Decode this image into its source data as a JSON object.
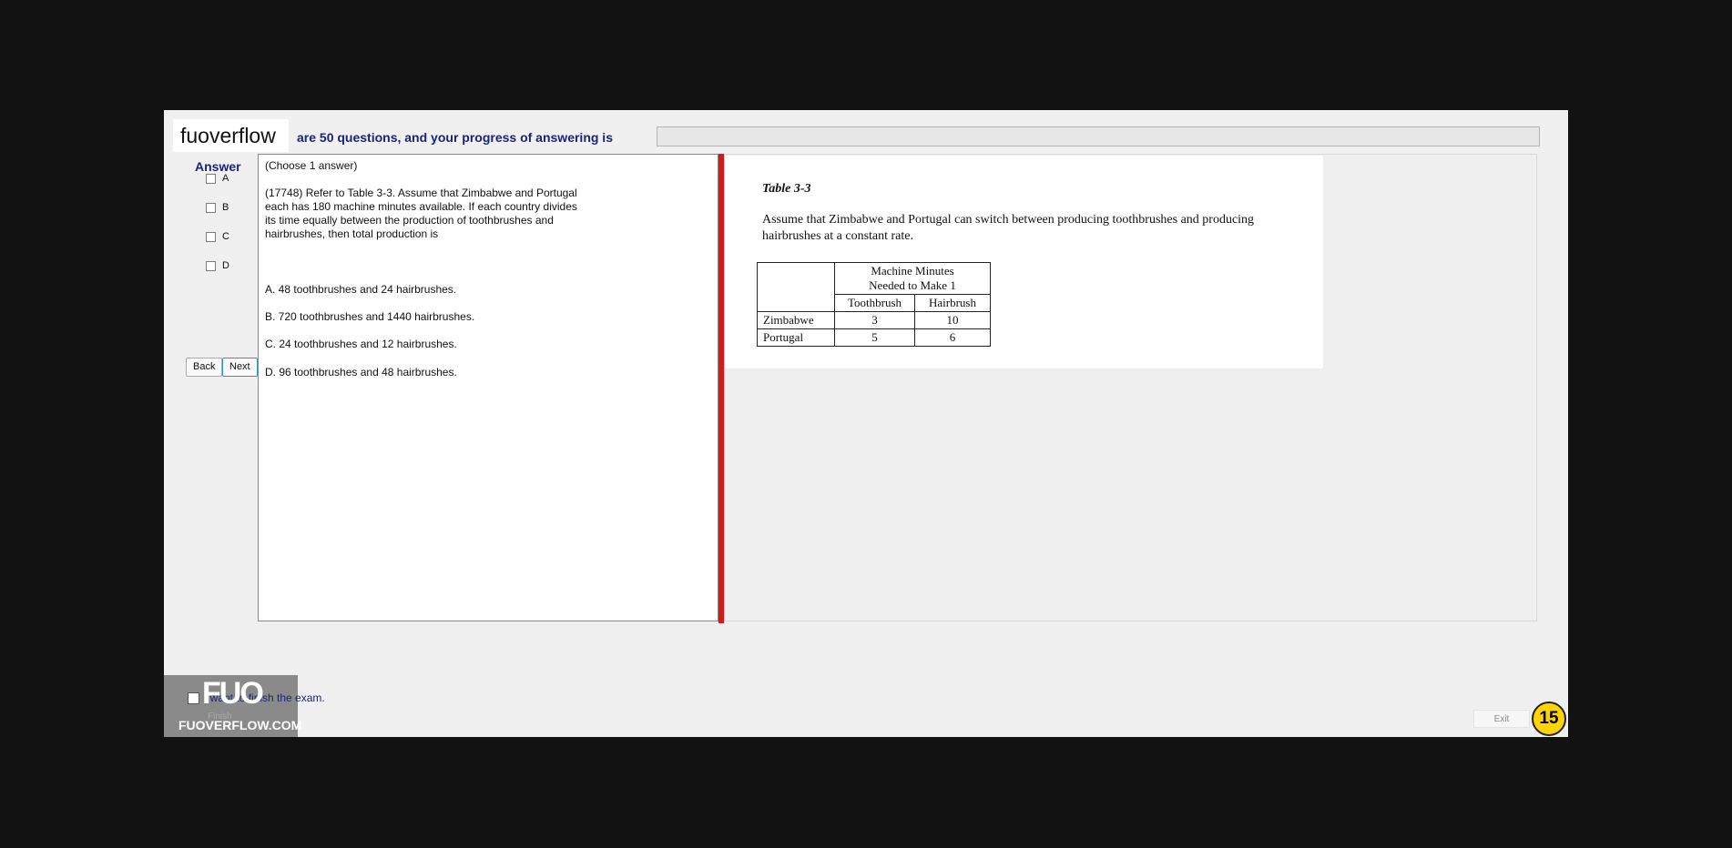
{
  "brand": "fuoverflow",
  "progress": {
    "text": "are 50 questions, and your progress of answering is"
  },
  "answer_panel": {
    "title": "Answer",
    "options": [
      "A",
      "B",
      "C",
      "D"
    ],
    "back_label": "Back",
    "next_label": "Next"
  },
  "question": {
    "instruction": "(Choose 1 answer)",
    "text": "(17748)  Refer to Table 3-3.  Assume that Zimbabwe and Portugal each has 180 machine minutes available.  If each country divides its time equally between the production of toothbrushes and hairbrushes, then total production is",
    "answers": [
      "A.  48 toothbrushes and 24 hairbrushes.",
      "B.  720 toothbrushes and 1440 hairbrushes.",
      "C.  24 toothbrushes and 12 hairbrushes.",
      "D.  96 toothbrushes and 48 hairbrushes."
    ]
  },
  "reference": {
    "title": "Table 3-3",
    "description": "Assume that Zimbabwe and Portugal can switch between producing toothbrushes and producing hairbrushes at a constant rate.",
    "header_line1": "Machine Minutes",
    "header_line2": "Needed to Make 1",
    "col1": "Toothbrush",
    "col2": "Hairbrush",
    "rows": [
      {
        "country": "Zimbabwe",
        "toothbrush": "3",
        "hairbrush": "10"
      },
      {
        "country": "Portugal",
        "toothbrush": "5",
        "hairbrush": "6"
      }
    ]
  },
  "footer": {
    "finish_text": "I want to finish the exam.",
    "finish_label": "Finish",
    "watermark_logo": "FUO",
    "watermark_domain": "FUOVERFLOW.COM",
    "exit_label": "Exit",
    "timer": "15"
  },
  "colors": {
    "accent_red": "#d21a1a",
    "heading_blue": "#1a237e",
    "timer_yellow": "#ffd400"
  }
}
